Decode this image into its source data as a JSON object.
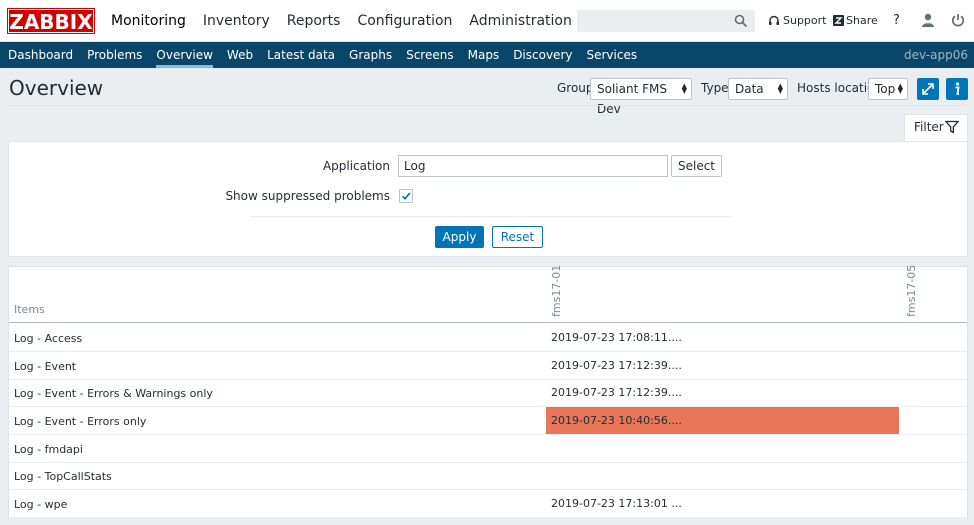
{
  "logo": "ZABBIX",
  "top_nav": [
    "Monitoring",
    "Inventory",
    "Reports",
    "Configuration",
    "Administration"
  ],
  "header_links": {
    "support": "Support",
    "share": "Share",
    "help": "?"
  },
  "sub_nav": [
    "Dashboard",
    "Problems",
    "Overview",
    "Web",
    "Latest data",
    "Graphs",
    "Screens",
    "Maps",
    "Discovery",
    "Services"
  ],
  "server_name": "dev-app06",
  "page": {
    "title": "Overview",
    "group_label": "Group",
    "group_value": "Soliant FMS Dev",
    "type_label": "Type",
    "type_value": "Data",
    "hosts_location_label": "Hosts location",
    "hosts_location_value": "Top"
  },
  "filter": {
    "tab_label": "Filter",
    "application_label": "Application",
    "application_value": "Log",
    "select_label": "Select",
    "suppressed_label": "Show suppressed problems",
    "suppressed_checked": true,
    "apply_label": "Apply",
    "reset_label": "Reset"
  },
  "table": {
    "items_header": "Items",
    "hosts": [
      "fms17-01",
      "fms17-05"
    ],
    "rows": [
      {
        "name": "Log - Access",
        "value": "2019-07-23 17:08:11....",
        "alert": false
      },
      {
        "name": "Log - Event",
        "value": "2019-07-23 17:12:39....",
        "alert": false
      },
      {
        "name": "Log - Event - Errors & Warnings only",
        "value": "2019-07-23 17:12:39....",
        "alert": false
      },
      {
        "name": "Log - Event - Errors only",
        "value": "2019-07-23 10:40:56....",
        "alert": true
      },
      {
        "name": "Log - fmdapi",
        "value": "",
        "alert": false
      },
      {
        "name": "Log - TopCallStats",
        "value": "",
        "alert": false
      },
      {
        "name": "Log - wpe",
        "value": "2019-07-23 17:13:01 ...",
        "alert": false
      }
    ]
  },
  "colors": {
    "brand_red": "#d40000",
    "nav_blue": "#0a466a",
    "accent_blue": "#0275b8",
    "alert_orange": "#e97659"
  }
}
